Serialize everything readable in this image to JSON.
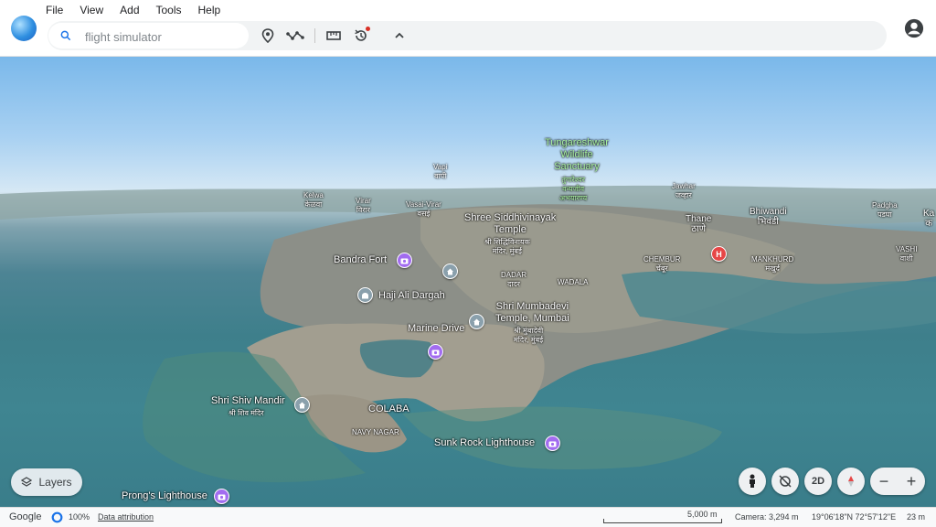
{
  "menu": [
    "File",
    "View",
    "Add",
    "Tools",
    "Help"
  ],
  "search": {
    "placeholder": "flight simulator"
  },
  "map": {
    "places": {
      "tungareshwar": "Tungareshwar\nWildlife\nSanctuary",
      "tungareshwar_hi": "तुंगारेश्वर\nवन्यजीव\nअभयारण्य",
      "vapi": "Vapi\nवापी",
      "kelwa": "Kelwa\nकेळवा",
      "virar": "Virar\nविरार",
      "vasai": "Vasai-Virar\nवसई",
      "jawhar": "Jawhar\nजव्हार",
      "bhiwandi": "Bhiwandi\nभिवंडी",
      "padgha": "Padgha\nपडघा",
      "ka": "Ka\nक",
      "thane": "Thane\nठाणे",
      "vashi": "VASHI\nवाशी",
      "siddhivinayak": "Shree Siddhivinayak\nTemple",
      "siddhivinayak_hi": "श्री सिद्धिविनायक\nमंदिर, मुंबई",
      "chembur": "CHEMBUR\nचेंबूर",
      "mankhurd": "MANKHURD\nमंखुर्द",
      "bandra": "Bandra Fort",
      "dadar": "DADAR\nदादर",
      "wadala": "WADALA",
      "haji_ali": "Haji Ali Dargah",
      "mumbadevi": "Shri Mumbadevi\nTemple, Mumbai",
      "mumbadevi_hi": "श्री मुंबादेवी\nमंदिर, मुंबई",
      "marine_drive": "Marine Drive",
      "shiv_mandir": "Shri Shiv Mandir",
      "shiv_mandir_hi": "श्री शिव मंदिर",
      "colaba": "COLABA",
      "navy_nagar": "NAVY NAGAR",
      "sunk_rock": "Sunk Rock Lighthouse",
      "prongs": "Prong's Lighthouse"
    }
  },
  "controls": {
    "layers_label": "Layers",
    "view_2d": "2D",
    "zoom_out": "−",
    "zoom_in": "+"
  },
  "status": {
    "google": "Google",
    "progress": "100%",
    "data_attribution": "Data attribution",
    "scale": "5,000 m",
    "camera": "Camera: 3,294 m",
    "coords": "19°06'18\"N 72°57'12\"E",
    "elevation": "23 m"
  },
  "colors": {
    "accent_blue": "#1a73e8",
    "photo_pin": "#a26cf0",
    "hospital_pin": "#e64646",
    "notification_dot": "#d93025"
  }
}
